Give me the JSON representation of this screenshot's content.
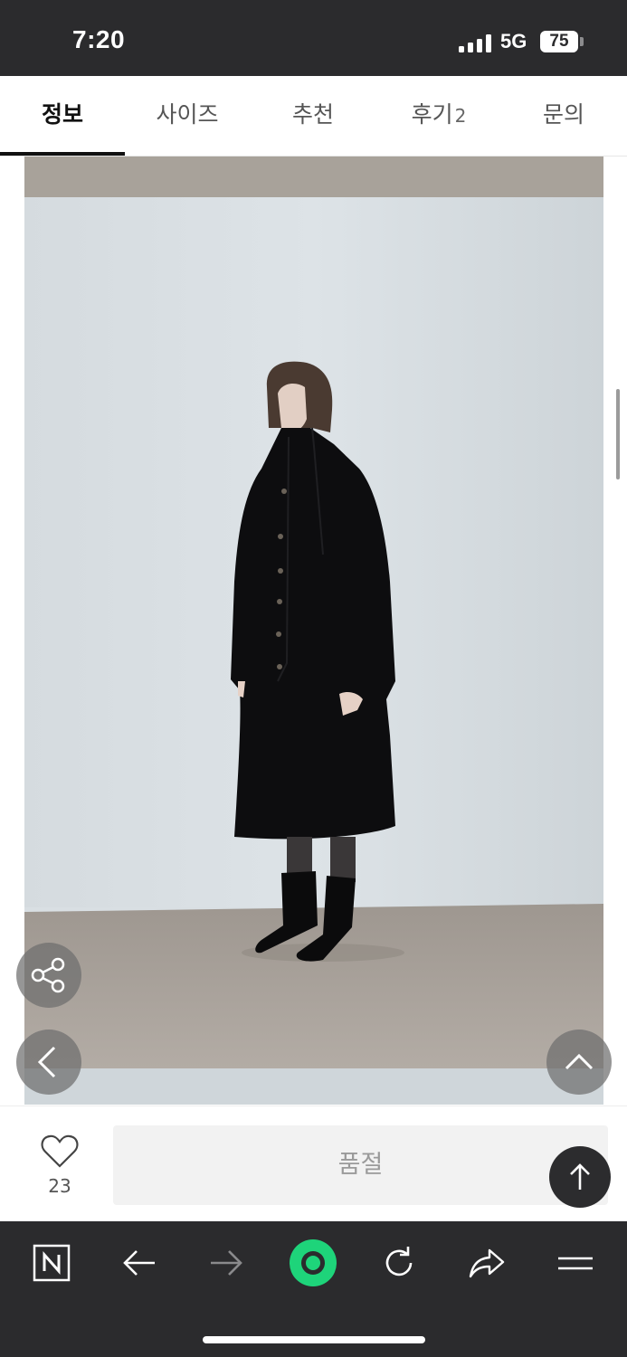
{
  "status_bar": {
    "time": "7:20",
    "network": "5G",
    "battery": "75"
  },
  "tabs": [
    {
      "label": "정보",
      "active": true
    },
    {
      "label": "사이즈",
      "active": false
    },
    {
      "label": "추천",
      "active": false
    },
    {
      "label": "후기",
      "count": "2",
      "active": false
    },
    {
      "label": "문의",
      "active": false
    }
  ],
  "floating": {
    "share_icon": "share-icon",
    "prev_icon": "chevron-left-icon",
    "up_icon": "chevron-up-icon",
    "top_icon": "arrow-up-icon"
  },
  "action_bar": {
    "like_count": "23",
    "soldout_label": "품절"
  },
  "browser_toolbar": {
    "icons": [
      "naver-icon",
      "back-arrow-icon",
      "forward-arrow-icon",
      "green-dot-icon",
      "reload-icon",
      "share-arrow-icon",
      "menu-icon"
    ]
  },
  "colors": {
    "dark_bar": "#2b2b2d",
    "accent_green": "#1ed47a",
    "soldout_bg": "#f2f2f2"
  }
}
